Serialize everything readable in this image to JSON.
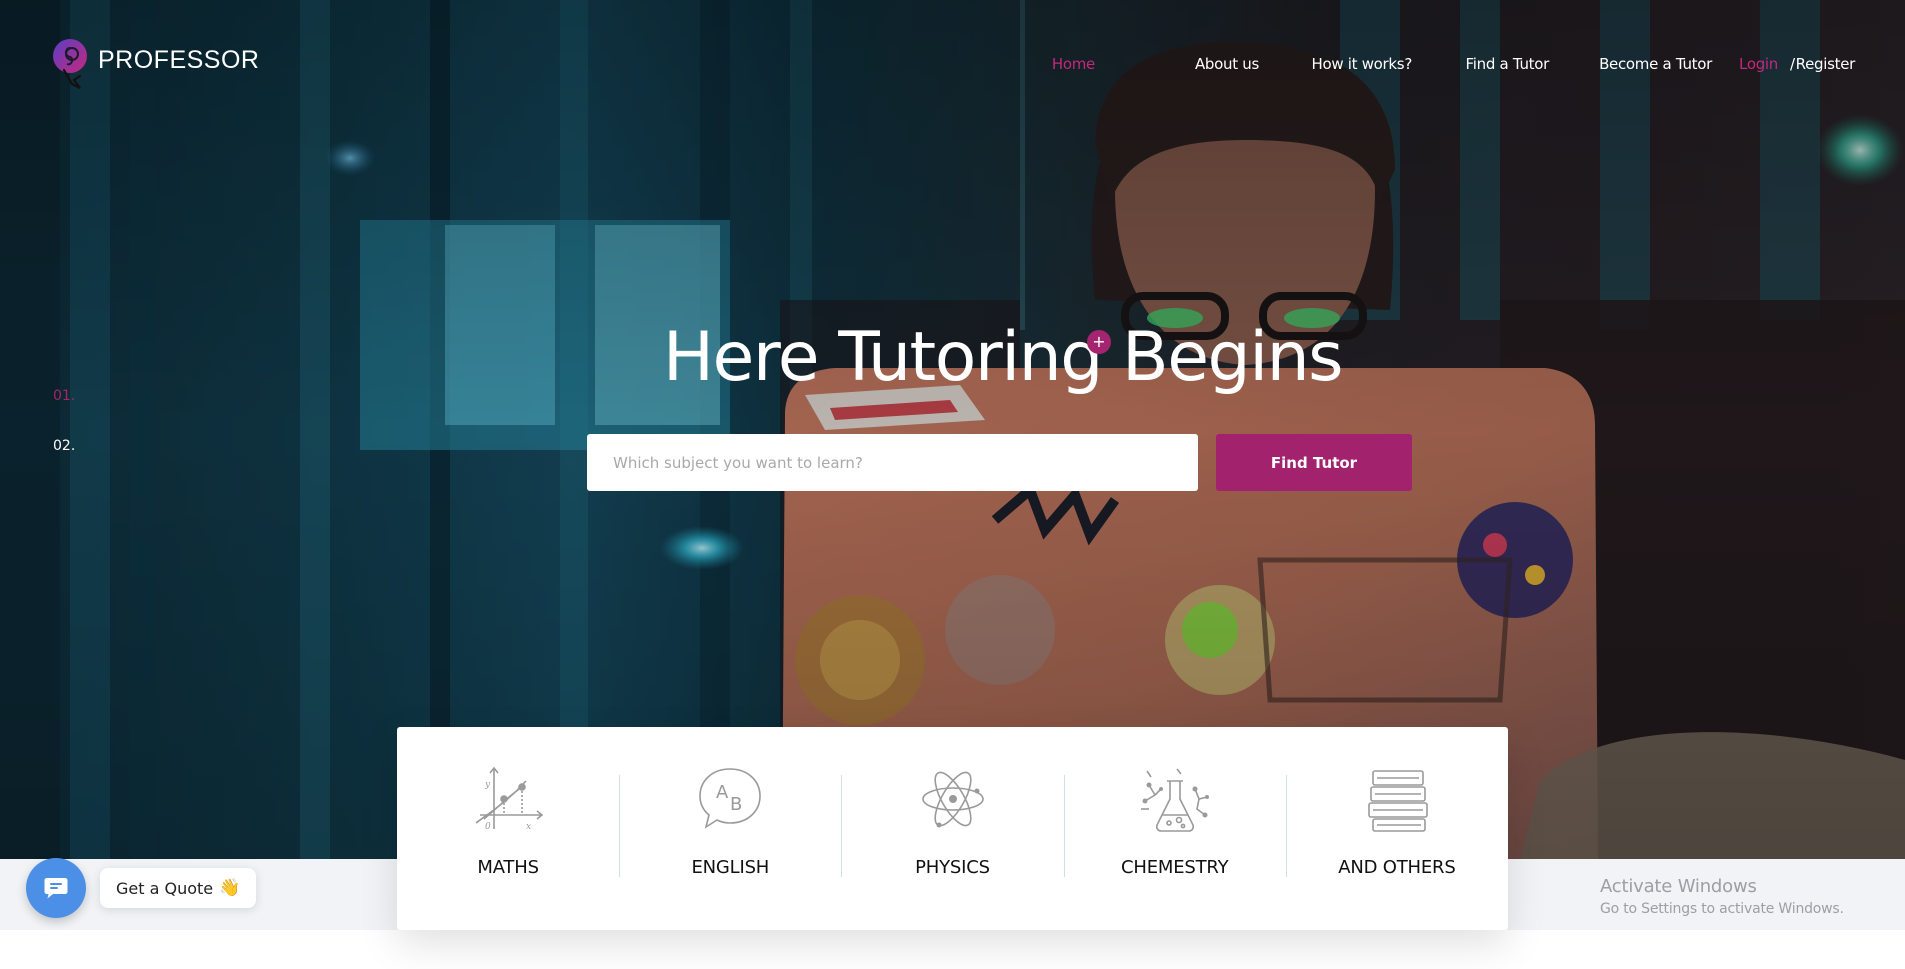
{
  "brand": {
    "name": "PROFESSOR",
    "logo_icon": "lightbulb-logo-icon"
  },
  "nav": {
    "home": "Home",
    "about": "About us",
    "how": "How it works?",
    "find_tutor": "Find a Tutor",
    "become_tutor": "Become a Tutor",
    "login": "Login",
    "separator": "/",
    "register": "Register"
  },
  "slider": {
    "indices": [
      "01.",
      "02."
    ],
    "active_index": 0
  },
  "hero": {
    "title": "Here Tutoring Begins",
    "plus_label": "+",
    "search_placeholder": "Which subject you want to learn?",
    "search_value": "",
    "button_label": "Find Tutor"
  },
  "subjects": [
    {
      "label": "MATHS",
      "icon": "graph-axes-icon"
    },
    {
      "label": "ENGLISH",
      "icon": "speech-bubble-ab-icon"
    },
    {
      "label": "PHYSICS",
      "icon": "atom-icon"
    },
    {
      "label": "CHEMESTRY",
      "icon": "flask-icon"
    },
    {
      "label": "AND OTHERS",
      "icon": "books-stack-icon"
    }
  ],
  "chat": {
    "icon": "chat-bubble-icon",
    "quote_label": "Get a Quote",
    "wave_emoji": "👋"
  },
  "watermark": {
    "title": "Activate Windows",
    "subtitle": "Go to Settings to activate Windows."
  },
  "colors": {
    "accent": "#a3226d",
    "chat_blue": "#4b8fe6",
    "strip": "#f1f3f6"
  }
}
